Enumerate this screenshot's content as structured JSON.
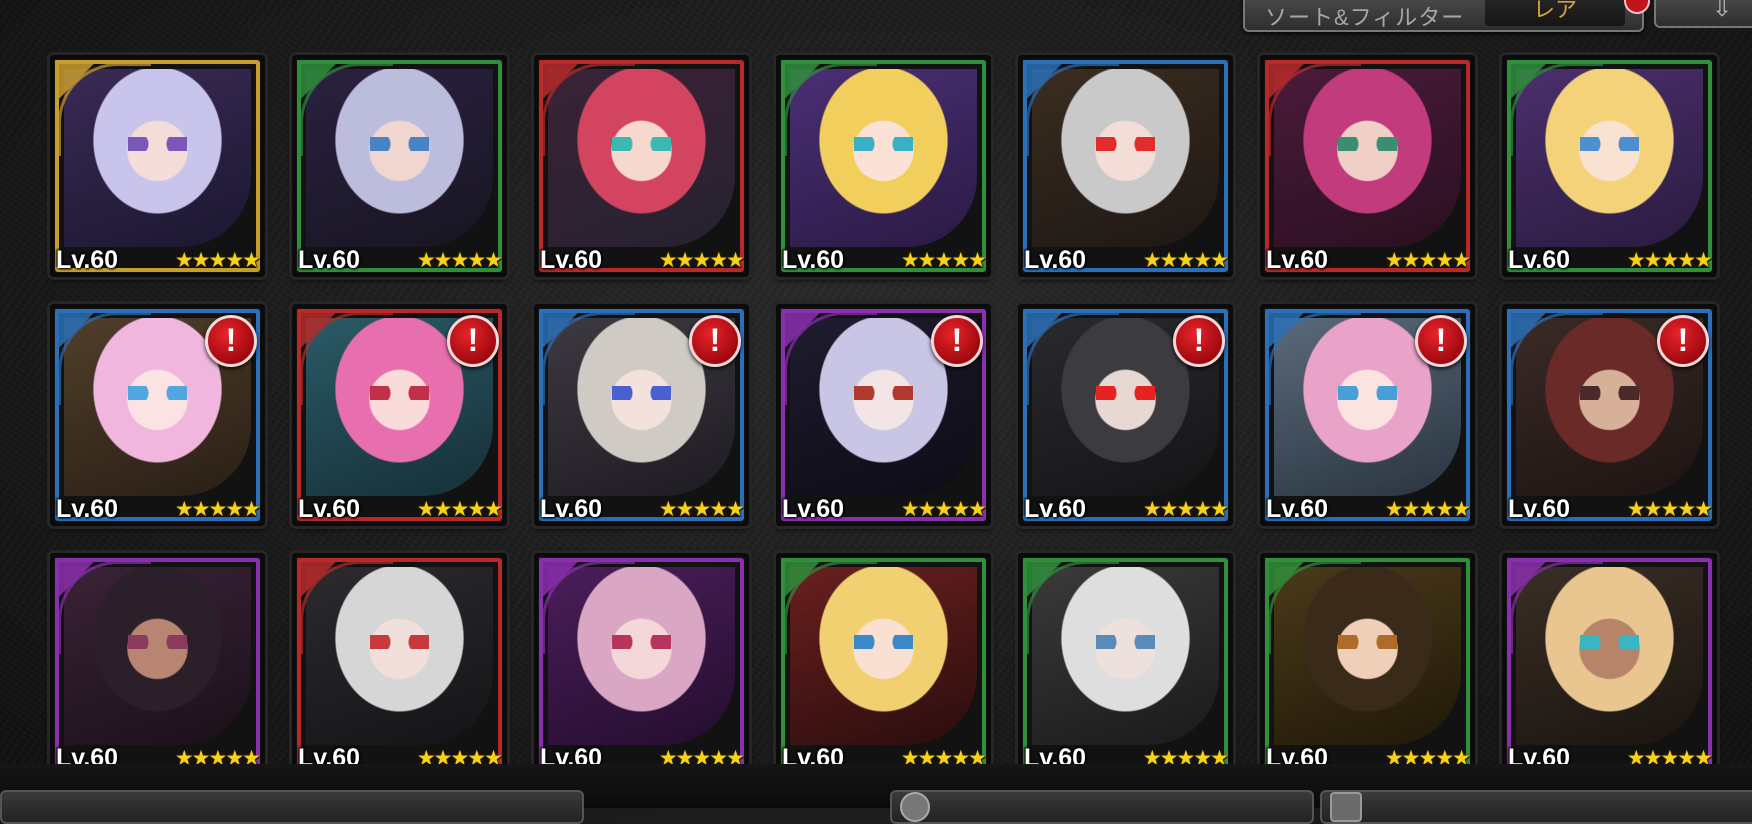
{
  "toolbar": {
    "sort_filter_label": "ソート&フィルター",
    "sort_value": "レア",
    "order_label": "⇩"
  },
  "units": [
    {
      "level": "Lv.60",
      "stars": "★★★★★",
      "frame": "#c79d2c",
      "alert": false,
      "hair": "#c9c4ec",
      "skin": "#f4dcd8",
      "eye": "#7a58b8",
      "bg1": "#3a2a55",
      "bg2": "#1b1730"
    },
    {
      "level": "Lv.60",
      "stars": "★★★★★",
      "frame": "#2f8f3b",
      "alert": false,
      "hair": "#bcbcdc",
      "skin": "#f0d6cf",
      "eye": "#4a83c4",
      "bg1": "#2b2140",
      "bg2": "#171521"
    },
    {
      "level": "Lv.60",
      "stars": "★★★★★",
      "frame": "#b82a2a",
      "alert": false,
      "hair": "#d2445f",
      "skin": "#f6d8cf",
      "eye": "#3db8b0",
      "bg1": "#3b2236",
      "bg2": "#25222f"
    },
    {
      "level": "Lv.60",
      "stars": "★★★★★",
      "frame": "#2f8f3b",
      "alert": false,
      "hair": "#f2cf5d",
      "skin": "#fae3d6",
      "eye": "#3ab0c7",
      "bg1": "#4a2f74",
      "bg2": "#2a1a45"
    },
    {
      "level": "Lv.60",
      "stars": "★★★★★",
      "frame": "#2a6fb8",
      "alert": false,
      "hair": "#c9c9c9",
      "skin": "#f3ddd6",
      "eye": "#e22b2b",
      "bg1": "#3b2d1f",
      "bg2": "#1d1715"
    },
    {
      "level": "Lv.60",
      "stars": "★★★★★",
      "frame": "#b82a2a",
      "alert": false,
      "hair": "#c23b7c",
      "skin": "#efcfc8",
      "eye": "#3a8f73",
      "bg1": "#4a1b3a",
      "bg2": "#2a0f20"
    },
    {
      "level": "Lv.60",
      "stars": "★★★★★",
      "frame": "#2f8f3b",
      "alert": false,
      "hair": "#f3d27a",
      "skin": "#fae2d3",
      "eye": "#4e8fd0",
      "bg1": "#4b2f6c",
      "bg2": "#2a1b40"
    },
    {
      "level": "Lv.60",
      "stars": "★★★★★",
      "frame": "#2a6fb8",
      "alert": true,
      "hair": "#f1b6de",
      "skin": "#fbe3e4",
      "eye": "#52a6df",
      "bg1": "#4f3e2a",
      "bg2": "#2a1f15"
    },
    {
      "level": "Lv.60",
      "stars": "★★★★★",
      "frame": "#b82a2a",
      "alert": true,
      "hair": "#e86fae",
      "skin": "#f9dcd9",
      "eye": "#c22f4b",
      "bg1": "#2a5a66",
      "bg2": "#163038"
    },
    {
      "level": "Lv.60",
      "stars": "★★★★★",
      "frame": "#2a6fb8",
      "alert": true,
      "hair": "#cfcac4",
      "skin": "#f3e2dc",
      "eye": "#4b5fd0",
      "bg1": "#3c3a40",
      "bg2": "#1e1c22"
    },
    {
      "level": "Lv.60",
      "stars": "★★★★★",
      "frame": "#8a2fae",
      "alert": true,
      "hair": "#c8c6e4",
      "skin": "#f3e5e6",
      "eye": "#b13a2e",
      "bg1": "#1e1c2e",
      "bg2": "#0d0c16"
    },
    {
      "level": "Lv.60",
      "stars": "★★★★★",
      "frame": "#2a6fb8",
      "alert": true,
      "hair": "#3b3b40",
      "skin": "#e8d8d4",
      "eye": "#e52323",
      "bg1": "#2a2a2e",
      "bg2": "#141416"
    },
    {
      "level": "Lv.60",
      "stars": "★★★★★",
      "frame": "#2a6fb8",
      "alert": true,
      "hair": "#eaa3c8",
      "skin": "#fbe3df",
      "eye": "#4a9ed6",
      "bg1": "#5a6a7a",
      "bg2": "#2a3440"
    },
    {
      "level": "Lv.60",
      "stars": "★★★★★",
      "frame": "#2a6fb8",
      "alert": true,
      "hair": "#6a2a28",
      "skin": "#d7b09a",
      "eye": "#4a2a2a",
      "bg1": "#3a2a26",
      "bg2": "#1d1412"
    },
    {
      "level": "Lv.60",
      "stars": "★★★★★",
      "frame": "#8a2fae",
      "alert": false,
      "hair": "#2b1f2a",
      "skin": "#b78572",
      "eye": "#8a3a5a",
      "bg1": "#3a2236",
      "bg2": "#1a1019"
    },
    {
      "level": "Lv.60",
      "stars": "★★★★★",
      "frame": "#b82a2a",
      "alert": false,
      "hair": "#d6d6d6",
      "skin": "#f1dfdc",
      "eye": "#c83a3a",
      "bg1": "#2c2a2e",
      "bg2": "#141316"
    },
    {
      "level": "Lv.60",
      "stars": "★★★★★",
      "frame": "#8a2fae",
      "alert": false,
      "hair": "#d9a7c4",
      "skin": "#f4d7d9",
      "eye": "#b6345e",
      "bg1": "#4a1e5a",
      "bg2": "#240d2e"
    },
    {
      "level": "Lv.60",
      "stars": "★★★★★",
      "frame": "#2f8f3b",
      "alert": false,
      "hair": "#f0d070",
      "skin": "#f9e0d2",
      "eye": "#3b88c9",
      "bg1": "#6a1f1f",
      "bg2": "#2a0d0d"
    },
    {
      "level": "Lv.60",
      "stars": "★★★★★",
      "frame": "#2f8f3b",
      "alert": false,
      "hair": "#dedede",
      "skin": "#eee0dc",
      "eye": "#5a8ab8",
      "bg1": "#3a3a3a",
      "bg2": "#1a1a1a"
    },
    {
      "level": "Lv.60",
      "stars": "★★★★★",
      "frame": "#2f8f3b",
      "alert": false,
      "hair": "#3a2a1a",
      "skin": "#f0cfb8",
      "eye": "#b06a2a",
      "bg1": "#4a3a1a",
      "bg2": "#201808"
    },
    {
      "level": "Lv.60",
      "stars": "★★★★★",
      "frame": "#8a2fae",
      "alert": false,
      "hair": "#e9c690",
      "skin": "#b7846a",
      "eye": "#3ab6c2",
      "bg1": "#3a2e26",
      "bg2": "#1a140f"
    }
  ]
}
